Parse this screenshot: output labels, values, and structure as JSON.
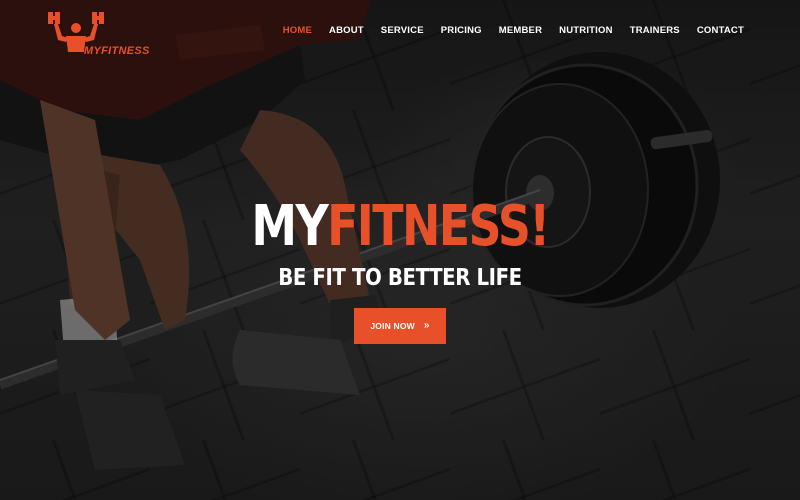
{
  "brand": {
    "logo_text": "MYFITNESS",
    "accent_color": "#e8502a"
  },
  "nav": {
    "items": [
      {
        "label": "HOME",
        "active": true
      },
      {
        "label": "ABOUT"
      },
      {
        "label": "SERVICE"
      },
      {
        "label": "PRICING"
      },
      {
        "label": "MEMBER"
      },
      {
        "label": "NUTRITION"
      },
      {
        "label": "TRAINERS"
      },
      {
        "label": "CONTACT"
      }
    ]
  },
  "hero": {
    "title_part1": "MY",
    "title_part2": "FITNESS!",
    "subtitle": "BE FIT TO BETTER LIFE",
    "cta_label": "JOIN NOW",
    "cta_icon": "double-chevron-right-icon",
    "background_image": "weightlifter deadlifting barbell on gym floor"
  }
}
